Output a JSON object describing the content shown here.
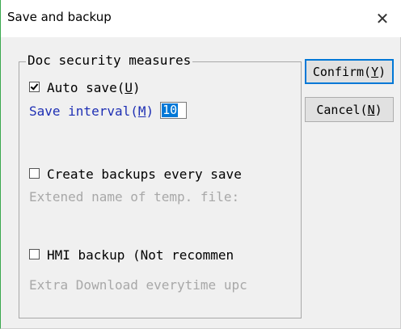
{
  "window": {
    "title": "Save and backup",
    "close_label": "✕"
  },
  "group": {
    "legend": "Doc security measures",
    "auto_save": {
      "label": "Auto save(",
      "mnemonic": "U",
      "suffix": ")",
      "checked": true
    },
    "save_interval": {
      "label": "Save interval(",
      "mnemonic": "M",
      "suffix": ")",
      "value": "10"
    },
    "create_backups": {
      "label": "Create backups every save",
      "checked": false
    },
    "temp_ext_label": "Extened name of temp. file:",
    "hmi_backup": {
      "label": "HMI backup (Not recommen",
      "checked": false
    },
    "extra_download_label": "Extra Download everytime upc"
  },
  "buttons": {
    "confirm": {
      "label": "Confirm(",
      "mnemonic": "Y",
      "suffix": ")"
    },
    "cancel": {
      "label": "Cancel(",
      "mnemonic": "N",
      "suffix": ")"
    }
  },
  "colors": {
    "accent_blue": "#1e2fb4",
    "selection": "#0078d7",
    "disabled_text": "#a8a8a8"
  }
}
